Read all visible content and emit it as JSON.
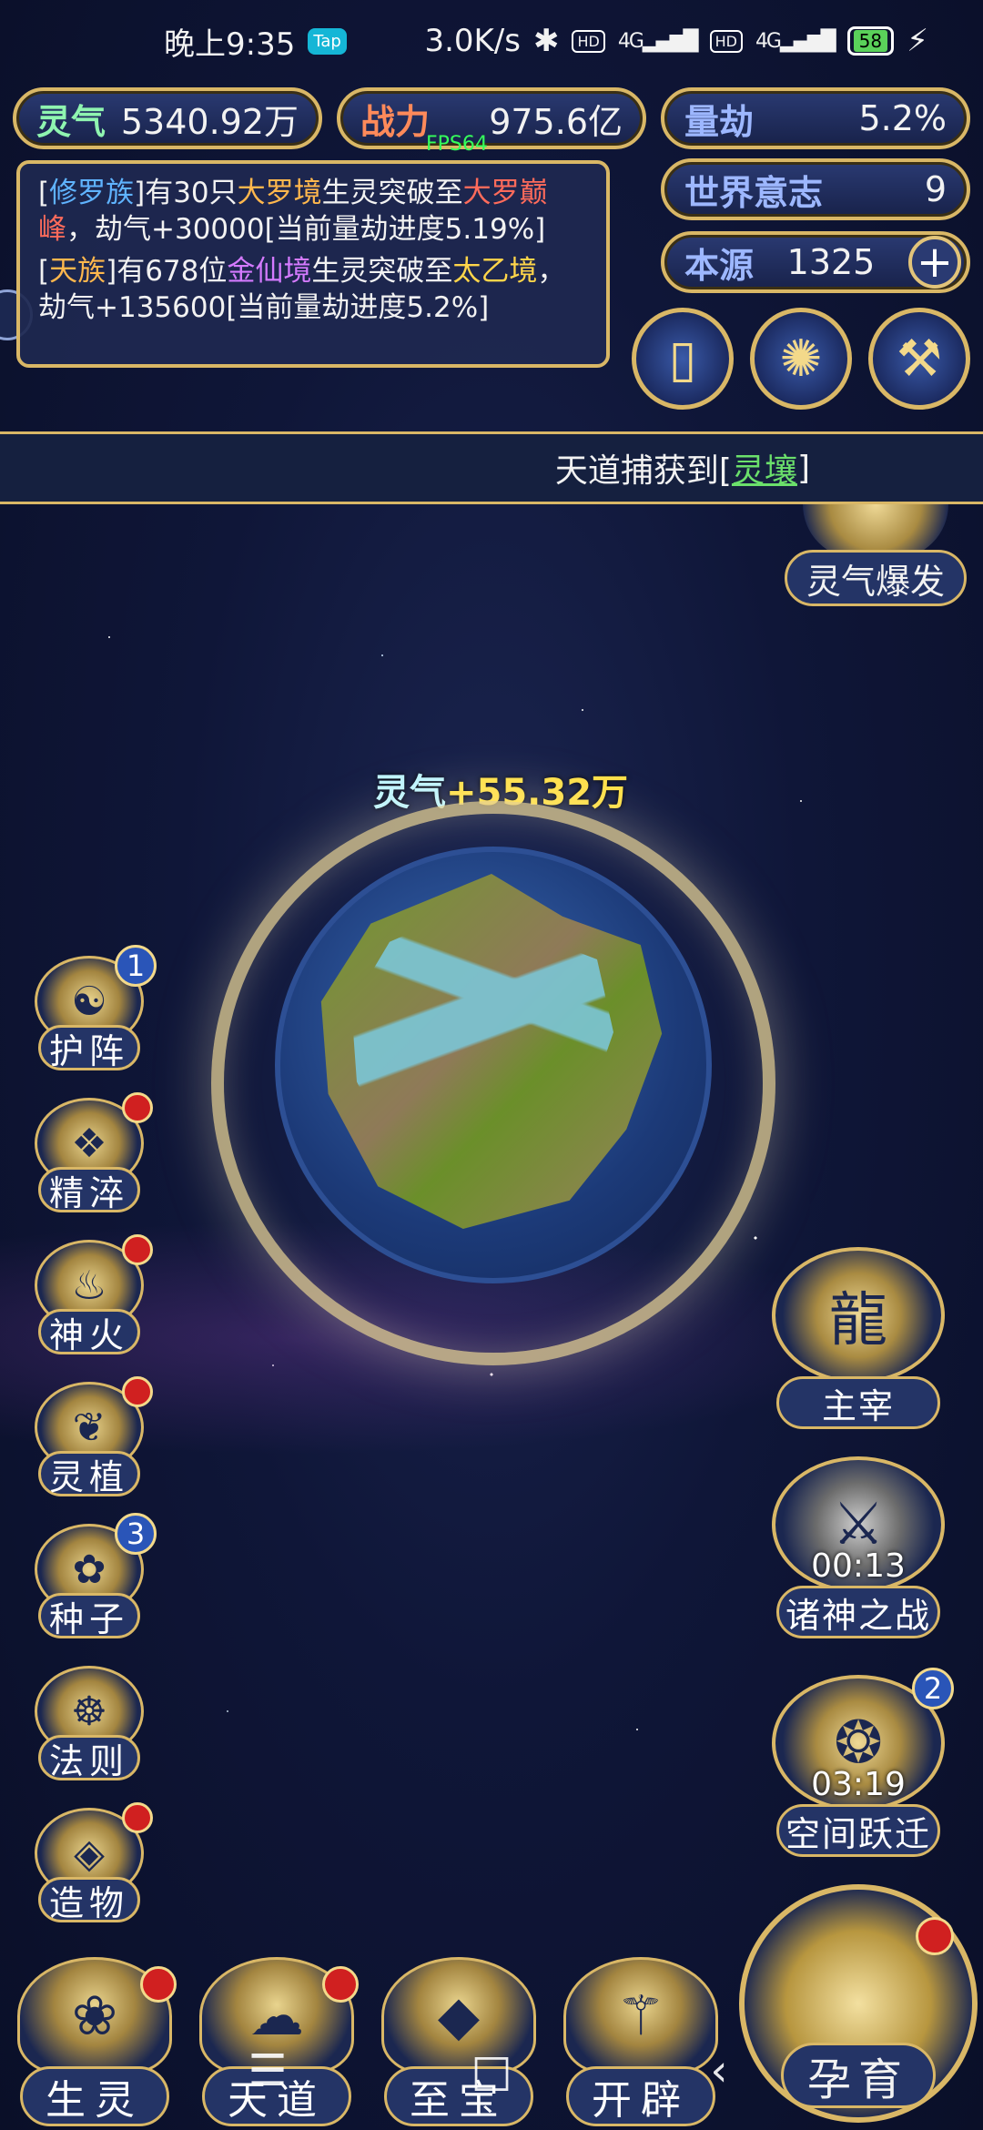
{
  "status_bar": {
    "time": "晚上9:35",
    "app_badge": "Tap",
    "net_speed": "3.0K/s",
    "hd1": "HD",
    "hd2": "HD",
    "net1": "4G",
    "net2": "4G",
    "battery": "58"
  },
  "resources": {
    "lingqi_label": "灵气",
    "lingqi_value": "5340.92万",
    "zhanli_label": "战力",
    "zhanli_value": "975.6亿",
    "liangjie_label": "量劫",
    "liangjie_value": "5.2%",
    "shijie_label": "世界意志",
    "shijie_value": "9",
    "benyuan_label": "本源",
    "benyuan_value": "1325",
    "plus_label": "+"
  },
  "fps": "FPS64",
  "log": {
    "line1": {
      "p1": "[",
      "race": "修罗族",
      "p2": "]有30只",
      "realm": "大罗境",
      "p3": "生灵突破至",
      "target": "大罗巅峰",
      "p4": "，劫气+30000[当前量劫进度5.19%]"
    },
    "line2": {
      "p1": "[",
      "race": "天族",
      "p2": "]有678位",
      "realm": "金仙境",
      "p3": "生灵突破至",
      "target": "太乙境",
      "p4": "，劫气+135600[当前量劫进度5.2%]"
    }
  },
  "banner": {
    "prefix": "天道捕获到[",
    "item": "灵壤",
    "suffix": "]"
  },
  "burst_label": "灵气爆发",
  "gain": {
    "label": "灵气",
    "value": "+55.32万"
  },
  "side_menu": [
    {
      "label": "护阵",
      "count": "1"
    },
    {
      "label": "精淬"
    },
    {
      "label": "神火"
    },
    {
      "label": "灵植"
    },
    {
      "label": "种子",
      "count": "3"
    },
    {
      "label": "法则"
    },
    {
      "label": "造物"
    }
  ],
  "right_menu": [
    {
      "label": "主宰"
    },
    {
      "label": "诸神之战",
      "timer": "00:13"
    },
    {
      "label": "空间跃迁",
      "timer": "03:19",
      "count": "2"
    }
  ],
  "bottom_nav": [
    {
      "label": "生灵"
    },
    {
      "label": "天道"
    },
    {
      "label": "至宝"
    },
    {
      "label": "开辟"
    }
  ],
  "nurture_label": "孕育",
  "icons": {
    "menu": "☰",
    "home": "□",
    "back": "‹"
  }
}
